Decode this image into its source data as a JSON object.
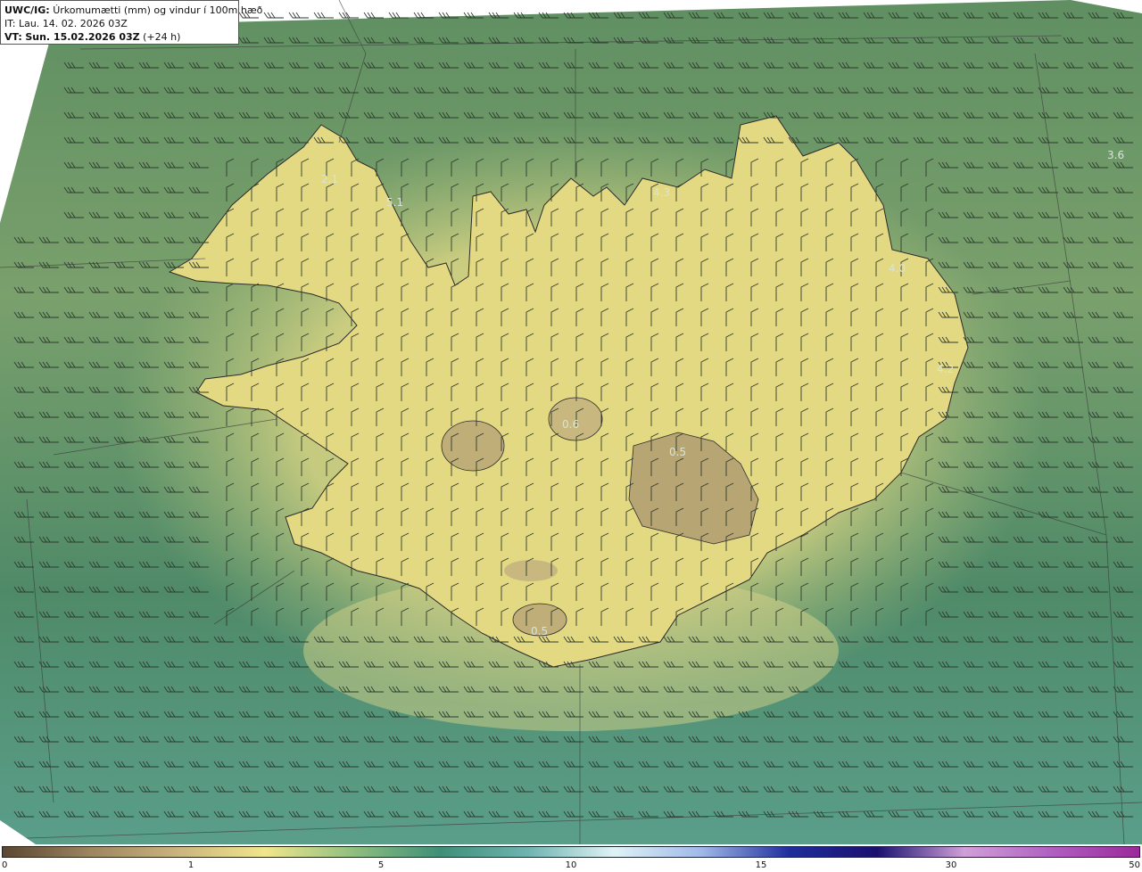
{
  "header": {
    "model": "UWC/IG:",
    "title": "Úrkomumætti (mm) og vindur í 100m hæð",
    "init_time": "IT: Lau. 14. 02. 2026 03Z",
    "valid_prefix": "VT:",
    "valid_time": "Sun. 15.02.2026 03Z",
    "lead": "(+24 h)"
  },
  "colorbar": {
    "ticks": [
      "0",
      "1",
      "5",
      "10",
      "15",
      "30",
      "50"
    ],
    "colors": [
      "#5a4632",
      "#9c8560",
      "#c9b47e",
      "#f0e68c",
      "#8fbf80",
      "#3f8f78",
      "#6fb3b0",
      "#dff3f6",
      "#9fb8e8",
      "#1f2e9c",
      "#1a0f6e",
      "#d0a0d8",
      "#b060c0",
      "#9a2a9a"
    ]
  },
  "map": {
    "sea_color": "#3f7d63",
    "land_color": "#e5db85",
    "highland_color": "#9a8a64",
    "labels": [
      {
        "text": "5.1",
        "name": "value-label-5-1"
      },
      {
        "text": "4.3",
        "name": "value-label-4-3"
      },
      {
        "text": "3.6",
        "name": "value-label-3-6"
      },
      {
        "text": "4.0",
        "name": "value-label-4-0"
      },
      {
        "text": "4.2",
        "name": "value-label-4-2"
      },
      {
        "text": "0.5",
        "name": "value-label-0-5"
      },
      {
        "text": "0.6",
        "name": "value-label-0-6"
      },
      {
        "text": "0.5",
        "name": "value-label-0-5-south"
      },
      {
        "text": "2.1",
        "name": "value-label-2-1"
      }
    ]
  }
}
